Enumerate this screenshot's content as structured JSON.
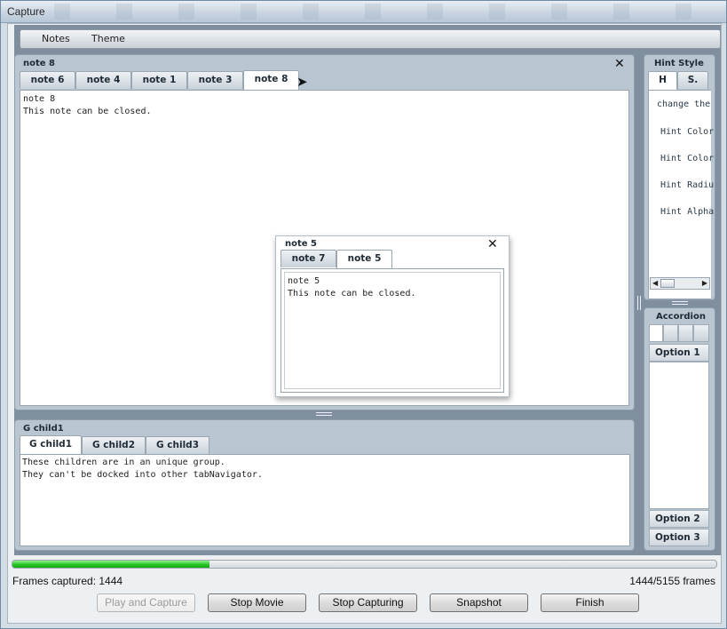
{
  "window": {
    "title": "Capture"
  },
  "menu": {
    "items": [
      "Notes",
      "Theme"
    ]
  },
  "main_panel": {
    "title": "note 8",
    "tabs": [
      "note 6",
      "note 4",
      "note 1",
      "note 3",
      "note 8"
    ],
    "active_tab": "note 8",
    "content_lines": [
      "note 8",
      "This note can be closed."
    ]
  },
  "floating_panel": {
    "title": "note 5",
    "tabs": [
      "note 7",
      "note 5"
    ],
    "active_tab": "note 5",
    "content_lines": [
      "note 5",
      "This note can be closed."
    ]
  },
  "group_panel": {
    "title": "G child1",
    "tabs": [
      "G child1",
      "G child2",
      "G child3"
    ],
    "active_tab": "G child1",
    "content_lines": [
      "These children are in an unique group.",
      "They can't be docked into other tabNavigator."
    ]
  },
  "hint_panel": {
    "title": "Hint Style",
    "tabs": [
      "H",
      "S."
    ],
    "items": [
      "change the",
      "Hint Color",
      "Hint Color",
      "Hint Radiu",
      "Hint Alpha"
    ]
  },
  "accordion_panel": {
    "title": "Accordion",
    "options": [
      "Option 1",
      "Option 2",
      "Option 3"
    ]
  },
  "capture": {
    "frames_captured_label": "Frames captured: 1444",
    "frames_ratio": "1444/5155 frames",
    "progress_fraction": 0.28,
    "buttons": {
      "play": "Play and Capture",
      "stop_movie": "Stop Movie",
      "stop_capturing": "Stop Capturing",
      "snapshot": "Snapshot",
      "finish": "Finish"
    }
  }
}
